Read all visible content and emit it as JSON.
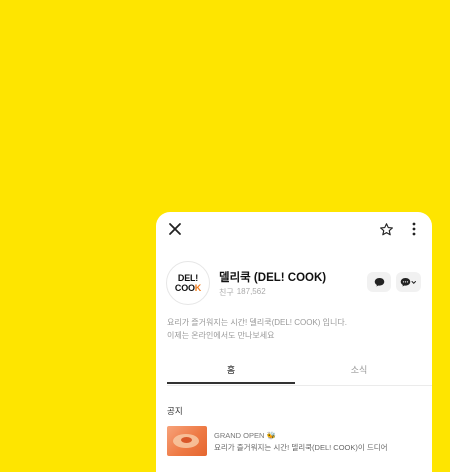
{
  "header": {
    "close_icon": "close-icon",
    "star_icon": "star-icon",
    "more_icon": "more-vertical-icon"
  },
  "profile": {
    "logo_line1": "DEL!",
    "logo_line2_a": "COO",
    "logo_line2_b": "K",
    "name": "델리쿡 (DEL! COOK)",
    "friends_label": "친구",
    "friends_count": "187,562",
    "chat_icon": "chat-bubble-icon",
    "channel_icon": "chat-add-icon"
  },
  "intro": {
    "line1": "요리가 즐거워지는 시간! 델리쿡(DEL! COOK) 입니다.",
    "line2": "이제는 온라인에서도 만나보세요"
  },
  "tabs": [
    "홈",
    "소식"
  ],
  "notice": {
    "section_title": "공지",
    "title": "GRAND OPEN",
    "title_emoji": "🐝",
    "text": "요리가 즐거워지는 시간! 델리쿡(DEL! COOK)이 드디어"
  },
  "colors": {
    "background": "#FEE500",
    "card": "#FFFFFF",
    "accent": "#F27A1A"
  }
}
